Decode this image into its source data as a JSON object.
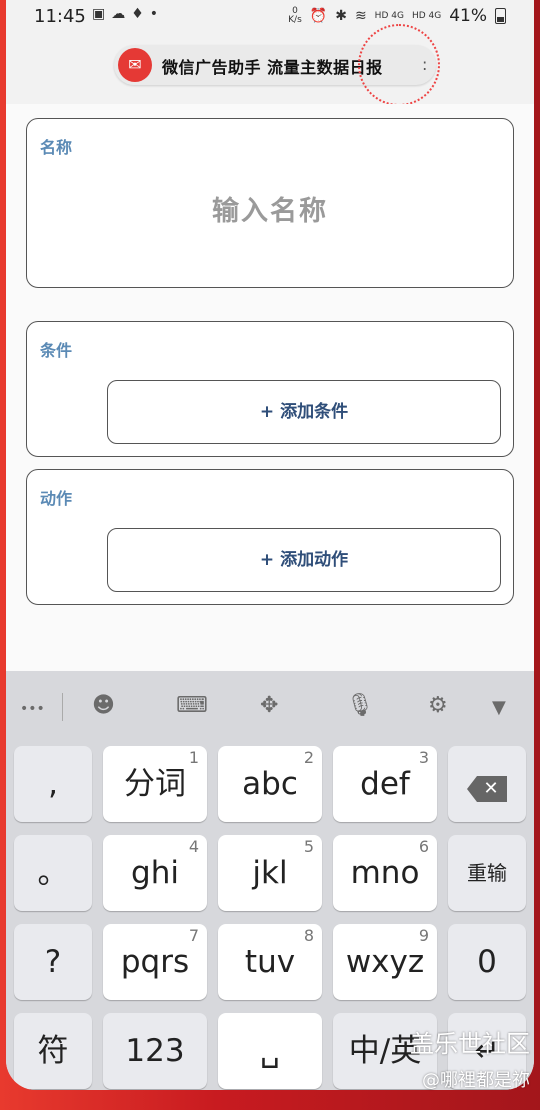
{
  "status_bar": {
    "time": "11:45",
    "left_icons": [
      "image-icon",
      "wechat-icon",
      "bulb-icon",
      "dot"
    ],
    "speed_top": "0",
    "speed_bottom": "K/s",
    "network_1": "HD 4G",
    "network_2": "HD 4G",
    "battery_percent": "41%"
  },
  "floating_pill": {
    "text": "微信广告助手  流量主数据日报",
    "suffix": ":"
  },
  "name_card": {
    "label": "名称",
    "placeholder": "输入名称"
  },
  "condition_card": {
    "label": "条件",
    "add_button": "+ 添加条件"
  },
  "action_card": {
    "label": "动作",
    "add_button": "+ 添加动作"
  },
  "keyboard": {
    "toolbar": {
      "more": "•••",
      "icons": [
        "emoji-icon",
        "keyboard-icon",
        "cursor-move-icon",
        "microphone-icon",
        "settings-icon",
        "collapse-icon"
      ]
    },
    "left_column": [
      ",",
      "。",
      "?",
      "符"
    ],
    "rows": [
      [
        {
          "label": "分词",
          "num": "1"
        },
        {
          "label": "abc",
          "num": "2"
        },
        {
          "label": "def",
          "num": "3"
        }
      ],
      [
        {
          "label": "ghi",
          "num": "4"
        },
        {
          "label": "jkl",
          "num": "5"
        },
        {
          "label": "mno",
          "num": "6"
        }
      ],
      [
        {
          "label": "pqrs",
          "num": "7"
        },
        {
          "label": "tuv",
          "num": "8"
        },
        {
          "label": "wxyz",
          "num": "9"
        }
      ]
    ],
    "right_column": [
      "⌫",
      "重输",
      "0"
    ],
    "bottom_row": [
      "123",
      "␣",
      "中/英"
    ]
  },
  "watermark": {
    "line1": "盖乐世社区",
    "line2": "@哪裡都是祢"
  }
}
